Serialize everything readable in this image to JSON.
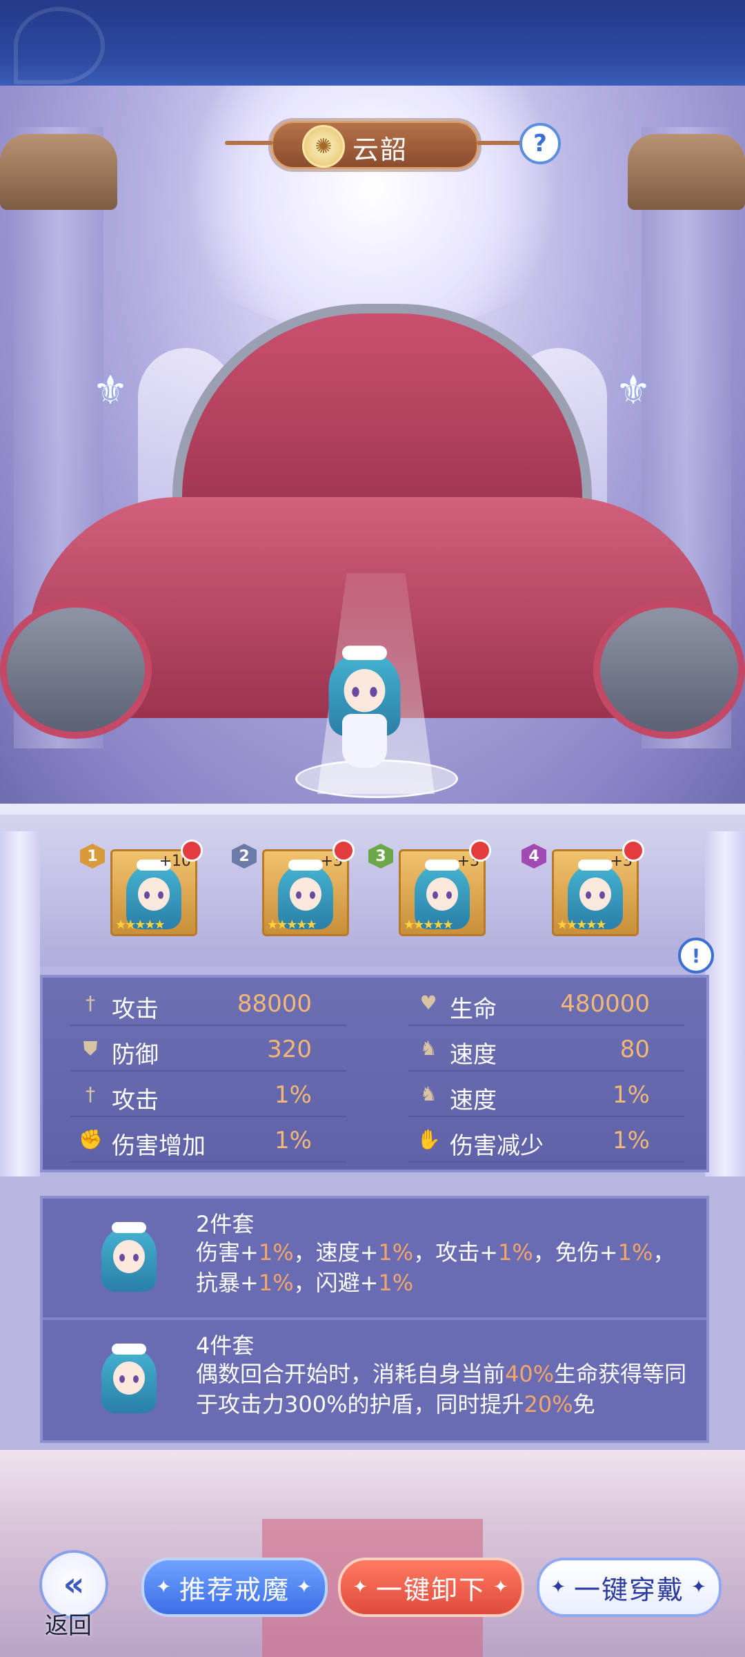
{
  "header": {
    "title": "云韶",
    "help_symbol": "?"
  },
  "slots": [
    {
      "index": "1",
      "level": "+10",
      "stars": "★★★★★",
      "color": "#d99a3b"
    },
    {
      "index": "2",
      "level": "+3",
      "stars": "★★★★★",
      "color": "#6b7aa8"
    },
    {
      "index": "3",
      "level": "+3",
      "stars": "★★★★★",
      "color": "#6aa84a"
    },
    {
      "index": "4",
      "level": "+3",
      "stars": "★★★★★",
      "color": "#a24ab3"
    }
  ],
  "info_symbol": "!",
  "stats": [
    {
      "label": "攻击",
      "value": "88000",
      "icon": "sword-icon"
    },
    {
      "label": "生命",
      "value": "480000",
      "icon": "heart-icon"
    },
    {
      "label": "防御",
      "value": "320",
      "icon": "shield-icon"
    },
    {
      "label": "速度",
      "value": "80",
      "icon": "boot-icon"
    },
    {
      "label": "攻击",
      "value": "1%",
      "icon": "sword-icon"
    },
    {
      "label": "速度",
      "value": "1%",
      "icon": "boot-icon"
    },
    {
      "label": "伤害增加",
      "value": "1%",
      "icon": "damage-up-icon"
    },
    {
      "label": "伤害减少",
      "value": "1%",
      "icon": "damage-down-icon"
    }
  ],
  "sets": [
    {
      "title": "2件套",
      "desc_parts": [
        "伤害+",
        "1%",
        "，速度+",
        "1%",
        "，攻击+",
        "1%",
        "，免伤+",
        "1%",
        "，抗暴+",
        "1%",
        "，闪避+",
        "1%"
      ]
    },
    {
      "title": "4件套",
      "desc_parts": [
        "偶数回合开始时，消耗自身当前",
        "40%",
        "生命获得等同于攻击力300%的护盾，同时提升",
        "20%",
        "免"
      ]
    }
  ],
  "footer": {
    "back_label": "返回",
    "recommend_label": "推荐戒魔",
    "unequip_label": "一键卸下",
    "equip_label": "一键穿戴"
  },
  "colors": {
    "accent_value": "#f3b878",
    "highlight": "#f2a76a",
    "alert_dot": "#e43c3c"
  }
}
